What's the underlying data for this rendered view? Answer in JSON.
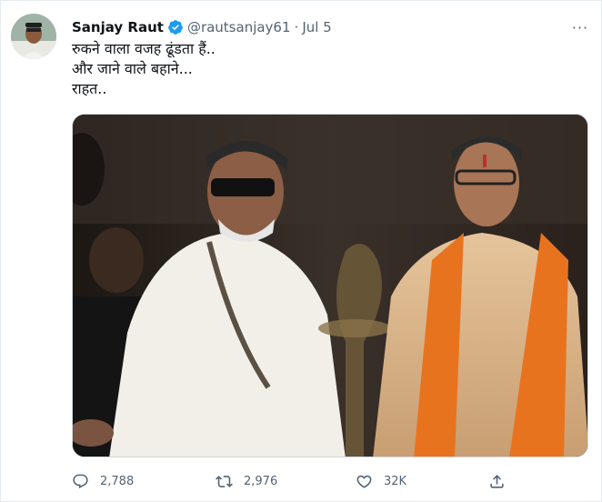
{
  "tweet": {
    "author_name": "Sanjay Raut",
    "handle": "@rautsanjay61",
    "separator": "·",
    "date": "Jul 5",
    "more_label": "···",
    "text_lines": [
      "रुकने वाला वजह ढूंडता हैं..",
      "और जाने वाले बहाने...",
      "राहत.."
    ]
  },
  "actions": {
    "reply_count": "2,788",
    "retweet_count": "2,976",
    "like_count": "32K"
  },
  "colors": {
    "verified": "#1d9bf0",
    "muted": "#536471",
    "border": "#e6ecf0"
  }
}
